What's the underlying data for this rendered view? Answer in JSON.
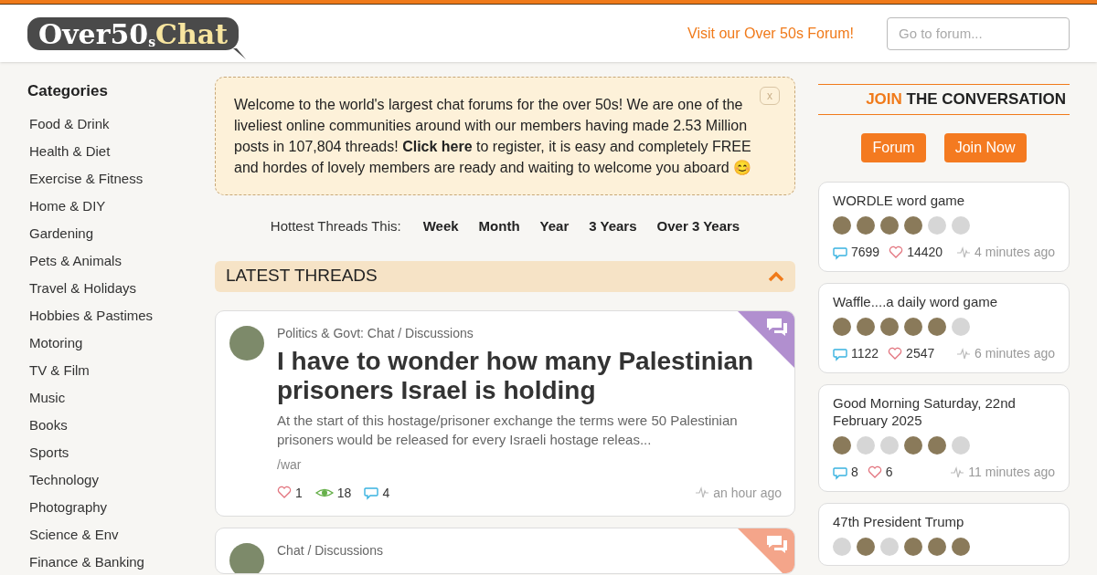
{
  "header": {
    "logo": {
      "main": "Over50",
      "small": "s",
      "accent": "Chat"
    },
    "forum_link": "Visit our Over 50s Forum!",
    "search": {
      "placeholder": "Go to forum..."
    }
  },
  "sidebar": {
    "title": "Categories",
    "items": [
      "Food & Drink",
      "Health & Diet",
      "Exercise & Fitness",
      "Home & DIY",
      "Gardening",
      "Pets & Animals",
      "Travel & Holidays",
      "Hobbies & Pastimes",
      "Motoring",
      "TV & Film",
      "Music",
      "Books",
      "Sports",
      "Technology",
      "Photography",
      "Science & Env",
      "Finance & Banking"
    ]
  },
  "welcome": {
    "text": "Welcome to the world's largest chat forums for the over 50s! We are one of the liveliest online communities around with our members having made 2.53 Million posts in 107,804 threads! **Click here** to register, it is easy and completely FREE and hordes of lovely members are ready and waiting to welcome you aboard 😊",
    "close": "x"
  },
  "hottest": {
    "label": "Hottest Threads This:",
    "periods": [
      "Week",
      "Month",
      "Year",
      "3 Years",
      "Over 3 Years"
    ]
  },
  "latest": {
    "title": "LATEST THREADS",
    "expanded": true
  },
  "threads": [
    {
      "category": "Politics & Govt: Chat / Discussions",
      "title": "I have to wonder how many Palestinian prisoners Israel is holding",
      "excerpt": "At the start of this hostage/prisoner exchange the terms were 50 Palestinian prisoners would be released for every Israeli hostage releas...",
      "tag": "/war",
      "likes": "1",
      "views": "18",
      "replies": "4",
      "time": "an hour ago",
      "color": "#b18fcf"
    },
    {
      "category": "Chat / Discussions",
      "color": "#f4a58a"
    }
  ],
  "join": {
    "heading_accent": "JOIN",
    "heading": "THE CONVERSATION",
    "buttons": [
      "Forum",
      "Join Now"
    ]
  },
  "topics": [
    {
      "title": "WORDLE word game",
      "avatars": [
        {
          "kind": "photo"
        },
        {
          "kind": "photo"
        },
        {
          "kind": "photo"
        },
        {
          "kind": "photo"
        },
        {
          "kind": "default"
        },
        {
          "kind": "default"
        }
      ],
      "replies": "7699",
      "likes": "14420",
      "time": "4 minutes ago"
    },
    {
      "title": "Waffle....a daily word game",
      "avatars": [
        {
          "kind": "photo"
        },
        {
          "kind": "photo"
        },
        {
          "kind": "photo"
        },
        {
          "kind": "photo"
        },
        {
          "kind": "photo"
        },
        {
          "kind": "default"
        }
      ],
      "replies": "1122",
      "likes": "2547",
      "time": "6 minutes ago"
    },
    {
      "title": "Good Morning Saturday, 22nd February 2025",
      "avatars": [
        {
          "kind": "photo"
        },
        {
          "kind": "default"
        },
        {
          "kind": "default"
        },
        {
          "kind": "photo"
        },
        {
          "kind": "photo"
        },
        {
          "kind": "default"
        }
      ],
      "replies": "8",
      "likes": "6",
      "time": "11 minutes ago"
    },
    {
      "title": "47th President Trump",
      "avatars": [
        {
          "kind": "default"
        },
        {
          "kind": "photo"
        },
        {
          "kind": "default"
        },
        {
          "kind": "photo"
        },
        {
          "kind": "photo"
        },
        {
          "kind": "photo"
        }
      ]
    }
  ]
}
